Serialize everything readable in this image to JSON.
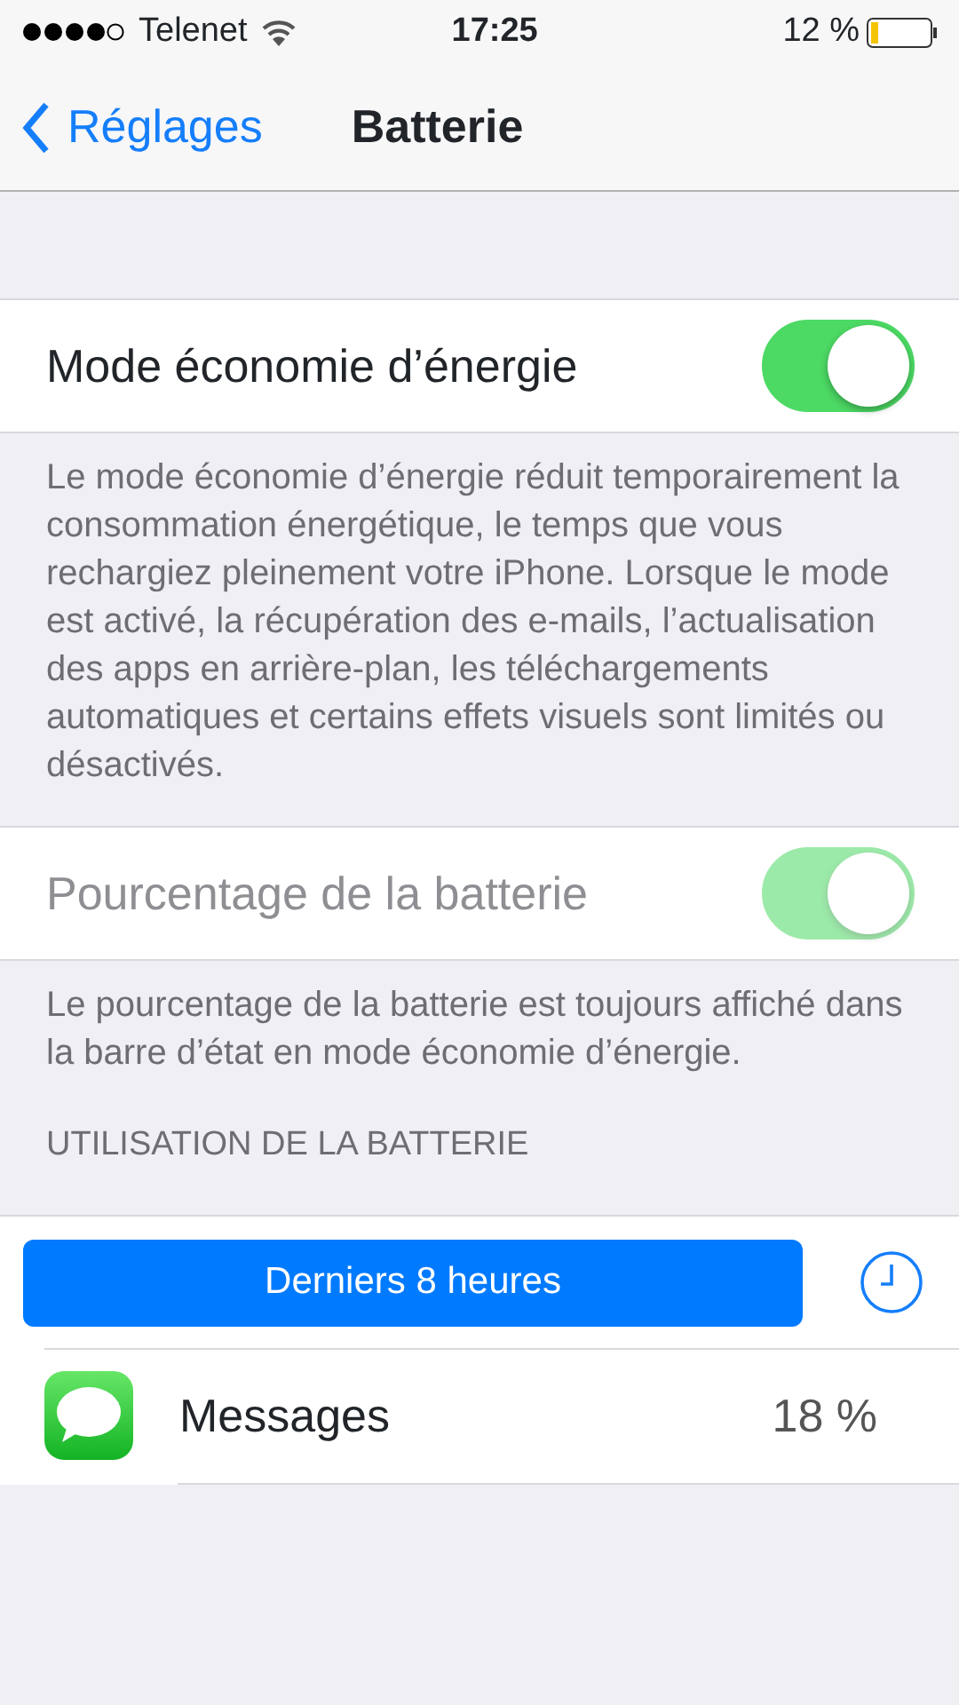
{
  "status_bar": {
    "carrier": "Telenet",
    "time": "17:25",
    "battery": "12 %"
  },
  "nav": {
    "back": "Réglages",
    "title": "Batterie"
  },
  "settings": [
    {
      "label": "Mode économie d’énergie",
      "on": true,
      "disabled": false,
      "footer": "Le mode économie d’énergie réduit temporairement la consommation énergétique, le temps que vous rechargiez pleinement votre iPhone. Lorsque le mode est activé, la récupération des e-mails, l’actualisation des apps en arrière-plan, les téléchargements automatiques et certains effets visuels sont limités ou désactivés."
    },
    {
      "label": "Pourcentage de la batterie",
      "on": true,
      "disabled": true,
      "footer": "Le pourcentage de la batterie est toujours affiché dans la barre d’état en mode économie d’énergie."
    }
  ],
  "usage": {
    "header": "UTILISATION DE LA BATTERIE",
    "period": "Derniers 8 heures",
    "apps": [
      {
        "name": "Messages",
        "value": "18 %"
      }
    ]
  }
}
